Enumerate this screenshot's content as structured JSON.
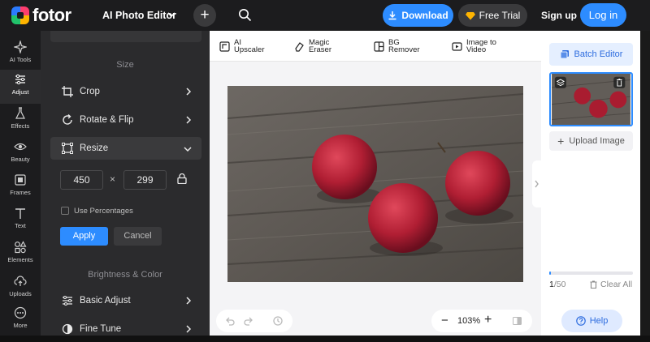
{
  "header": {
    "logo_text": "fotor",
    "product_label": "AI Photo Editor",
    "download_label": "Download",
    "trial_label": "Free Trial",
    "signup_label": "Sign up",
    "login_label": "Log in"
  },
  "rail": {
    "items": [
      {
        "label": "AI Tools"
      },
      {
        "label": "Adjust"
      },
      {
        "label": "Effects"
      },
      {
        "label": "Beauty"
      },
      {
        "label": "Frames"
      },
      {
        "label": "Text"
      },
      {
        "label": "Elements"
      },
      {
        "label": "Uploads"
      },
      {
        "label": "More"
      }
    ],
    "active": "Adjust"
  },
  "panel": {
    "size_title": "Size",
    "crop_label": "Crop",
    "rotate_label": "Rotate & Flip",
    "resize_label": "Resize",
    "width_value": "450",
    "times_symbol": "×",
    "height_value": "299",
    "use_percentages_label": "Use Percentages",
    "apply_label": "Apply",
    "cancel_label": "Cancel",
    "brightness_title": "Brightness & Color",
    "basic_adjust_label": "Basic Adjust",
    "fine_tune_label": "Fine Tune"
  },
  "features": {
    "upscaler_l1": "AI",
    "upscaler_l2": "Upscaler",
    "eraser_l1": "Magic",
    "eraser_l2": "Eraser",
    "bg_l1": "BG",
    "bg_l2": "Remover",
    "video_l1": "Image to",
    "video_l2": "Video"
  },
  "zoom": {
    "value": "103%",
    "minus": "−",
    "plus": "+"
  },
  "right_panel": {
    "batch_label": "Batch Editor",
    "upload_label": "Upload Image",
    "count_current": "1",
    "count_total": "/50",
    "clear_label": "Clear All",
    "progress_fraction": 0.02
  },
  "help_label": "Help",
  "colors": {
    "accent": "#2d8cff",
    "panel_dark": "#2b2b2d",
    "rail_dark": "#1c1c1e"
  }
}
